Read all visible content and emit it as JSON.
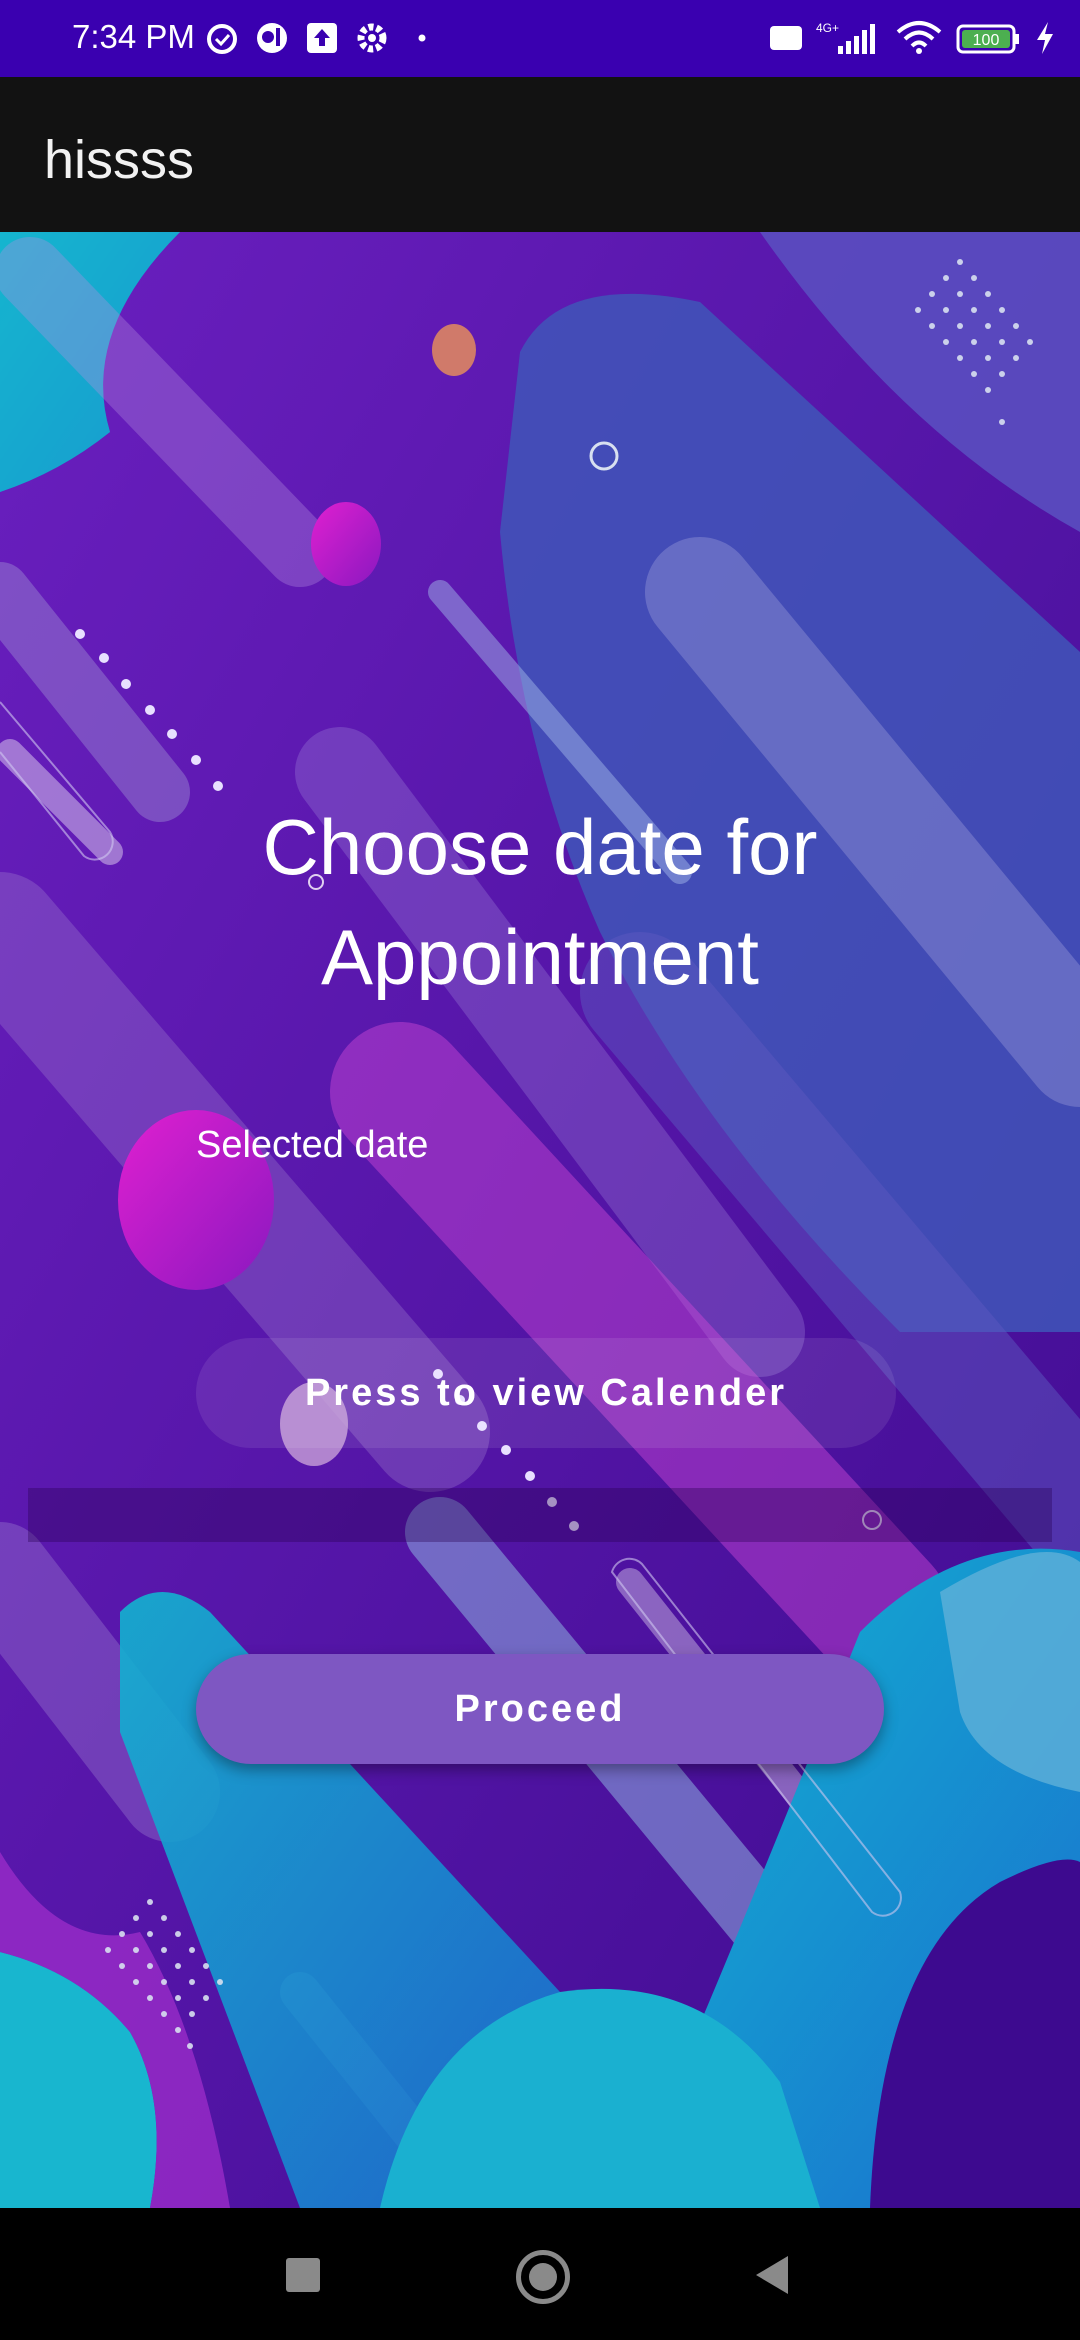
{
  "status_bar": {
    "time": "7:34 PM",
    "left_icons": [
      "alarm-icon",
      "app-icon",
      "upload-icon",
      "settings-icon",
      "dot-icon"
    ],
    "right_icons": [
      "volte-icon",
      "signal-icon",
      "wifi-icon",
      "battery-icon",
      "charging-icon"
    ],
    "network": "4G+",
    "volte": "Vo LTE",
    "battery": "100"
  },
  "app_bar": {
    "title": "hissss"
  },
  "main": {
    "heading_line1": "Choose date for",
    "heading_line2": "Appointment",
    "selected_label": "Selected date",
    "calendar_button": "Press to view Calender",
    "proceed_button": "Proceed"
  },
  "nav_bar": {
    "buttons": [
      "recents-icon",
      "home-icon",
      "back-icon"
    ]
  },
  "colors": {
    "status_bar": "#3a00b0",
    "app_bar": "#121212",
    "proceed_button": "#7e57c2"
  }
}
